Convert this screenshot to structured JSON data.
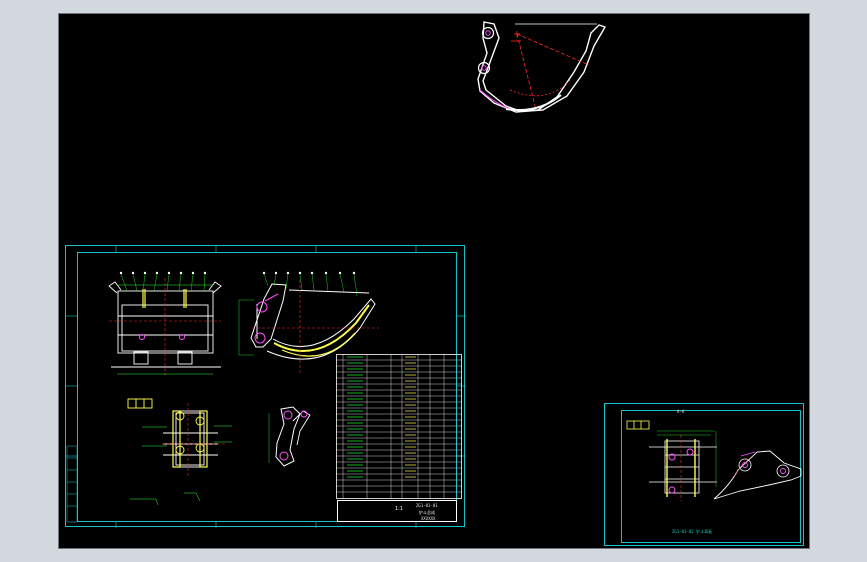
{
  "viewport": {
    "name": "cad-model-space",
    "background": "#000000",
    "border_color": "#6f7680"
  },
  "colors": {
    "cyan": "#17c3c8",
    "white": "#ffffff",
    "red": "#ff2a2a",
    "yellow": "#ffff4a",
    "magenta": "#ff4dff",
    "green": "#29ff2f"
  },
  "main_sheet": {
    "title_block": {
      "scale": "1:1",
      "drawing_no": "ZG1-01-01",
      "name": "铲斗总成",
      "company": "XXXXXX"
    }
  },
  "secondary_sheet": {
    "section_label": "A-A",
    "note": "ZG1-01-02 铲斗耳板"
  }
}
